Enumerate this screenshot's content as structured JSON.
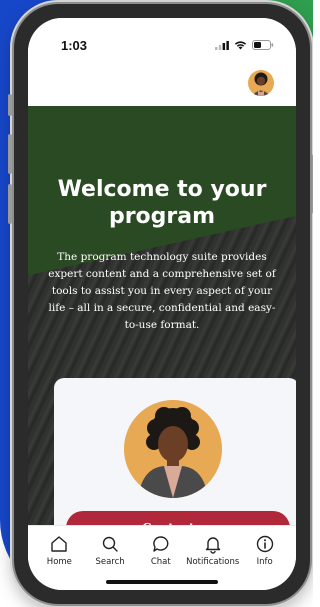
{
  "status_bar": {
    "time": "1:03",
    "icons": [
      "signal-icon",
      "wifi-icon",
      "battery-icon"
    ]
  },
  "header": {
    "avatar": "user-avatar"
  },
  "hero": {
    "title": "Welcome to your program",
    "description": "The program technology suite provides expert content and a comprehensive set of tools to assist you in every aspect of your life – all in a secure, confidential and easy-to-use format."
  },
  "card": {
    "avatar": "person-avatar-illustration",
    "button_label": "Contact us"
  },
  "tabbar": {
    "items": [
      {
        "label": "Home",
        "icon": "home-icon"
      },
      {
        "label": "Search",
        "icon": "search-icon"
      },
      {
        "label": "Chat",
        "icon": "chat-icon"
      },
      {
        "label": "Notifications",
        "icon": "bell-icon"
      },
      {
        "label": "Info",
        "icon": "info-icon"
      }
    ]
  },
  "colors": {
    "hero_green": "#2a4a23",
    "button_red": "#b1283b",
    "avatar_orange": "#e8a955",
    "bg_blue": "#1747c9",
    "bg_green": "#2f9e4f"
  }
}
